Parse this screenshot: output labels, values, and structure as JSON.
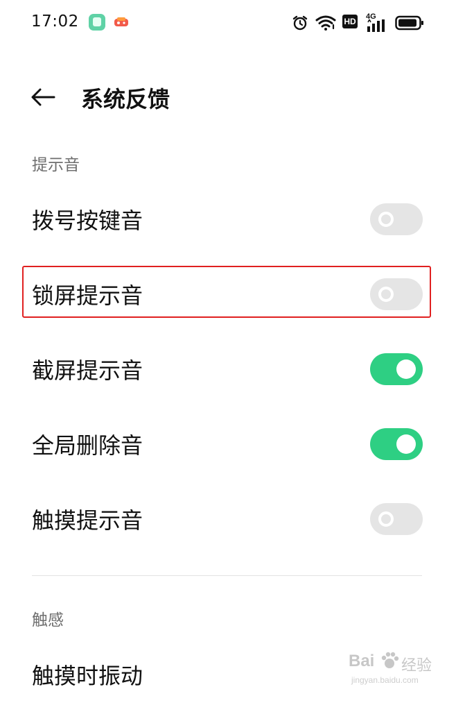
{
  "status_bar": {
    "time": "17:02",
    "icons": [
      "app-notification-icon",
      "game-icon",
      "alarm-icon",
      "wifi-icon",
      "hd-icon",
      "signal-4g-icon",
      "battery-icon"
    ],
    "hd_label": "HD",
    "network_label": "4G"
  },
  "header": {
    "back_icon": "back-arrow-icon",
    "title": "系统反馈"
  },
  "sections": [
    {
      "title": "提示音",
      "items": [
        {
          "label": "拨号按键音",
          "enabled": false
        },
        {
          "label": "锁屏提示音",
          "enabled": false,
          "highlighted": true
        },
        {
          "label": "截屏提示音",
          "enabled": true
        },
        {
          "label": "全局删除音",
          "enabled": true
        },
        {
          "label": "触摸提示音",
          "enabled": false
        }
      ]
    },
    {
      "title": "触感",
      "items": [
        {
          "label": "触摸时振动"
        }
      ]
    }
  ],
  "colors": {
    "toggle_on": "#2ecf83",
    "toggle_off": "#e5e5e5",
    "highlight": "#e02020"
  },
  "watermark": {
    "brand": "Bai",
    "suffix": "经验",
    "url": "jingyan.baidu.com"
  }
}
